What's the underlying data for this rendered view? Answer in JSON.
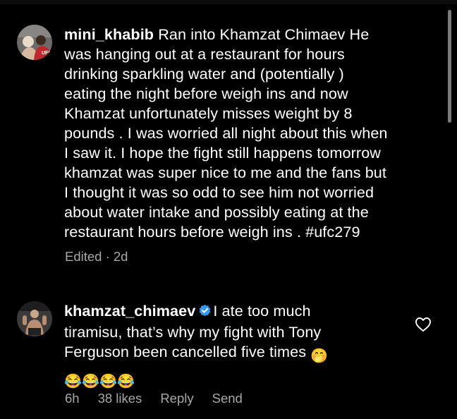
{
  "comments": [
    {
      "username": "mini_khabib",
      "lines": [
        "Ran into Khamzat Chimaev He",
        "was hanging out at a restaurant for hours",
        "drinking sparkling water and (potentially )",
        "eating the night before weigh ins and now",
        "Khamzat unfortunately misses weight by 8",
        "pounds . I was worried all night about this when",
        "I saw it. I hope the fight still happens tomorrow",
        "khamzat was super nice to me and the fans but",
        "I thought it was so odd to see him not worried",
        "about water intake and possibly eating at the",
        "restaurant hours before weigh ins . #ufc279"
      ],
      "meta": {
        "edited": "Edited · 2d"
      },
      "avatar_icon": "avatar-photo-ufc",
      "avatar_badge": "UFC"
    },
    {
      "username": "khamzat_chimaev",
      "verified_icon": "verified-badge-icon",
      "lines": [
        "I ate too much",
        "tiramisu, that’s why my fight with Tony",
        "Ferguson been cancelled five times"
      ],
      "emoji_line": [
        "😂",
        "😂",
        "😂",
        "😂"
      ],
      "trailing_emoji": "🤭",
      "meta": {
        "time": "6h",
        "likes": "38 likes",
        "reply": "Reply",
        "send": "Send"
      },
      "avatar_icon": "avatar-photo-fighter"
    }
  ],
  "colors": {
    "background": "#000000",
    "text": "#ffffff",
    "meta": "#a8a8a8",
    "verified": "#3897f0"
  }
}
